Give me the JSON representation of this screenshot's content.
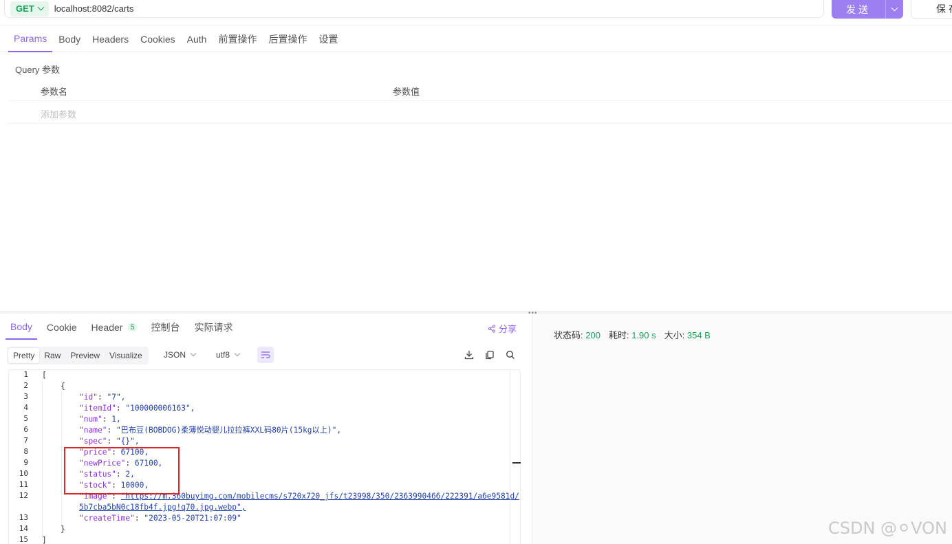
{
  "request": {
    "method": "GET",
    "url": "localhost:8082/carts",
    "send_label": "发送",
    "save_label": "保存"
  },
  "request_tabs": [
    "Params",
    "Body",
    "Headers",
    "Cookies",
    "Auth",
    "前置操作",
    "后置操作",
    "设置"
  ],
  "params": {
    "section_title": "Query 参数",
    "col_name": "参数名",
    "col_value": "参数值",
    "add_placeholder": "添加参数"
  },
  "response_tabs": {
    "body": "Body",
    "cookie": "Cookie",
    "header": "Header",
    "header_count": "5",
    "console": "控制台",
    "actual_request": "实际请求",
    "share": "分享"
  },
  "view_modes": [
    "Pretty",
    "Raw",
    "Preview",
    "Visualize"
  ],
  "format": {
    "type": "JSON",
    "encoding": "utf8"
  },
  "status": {
    "code_label": "状态码:",
    "code": "200",
    "time_label": "耗时:",
    "time": "1.90 s",
    "size_label": "大小:",
    "size": "354 B"
  },
  "code_lines": [
    {
      "n": "1",
      "text": "["
    },
    {
      "n": "2",
      "text": "    {"
    },
    {
      "n": "3",
      "key": "id",
      "val": "\"7\","
    },
    {
      "n": "4",
      "key": "itemId",
      "val": "\"100000006163\","
    },
    {
      "n": "5",
      "key": "num",
      "val": "1,"
    },
    {
      "n": "6",
      "key": "name",
      "val": "\"巴布豆(BOBDOG)柔薄悦动婴儿拉拉裤XXL码80片(15kg以上)\","
    },
    {
      "n": "7",
      "key": "spec",
      "val": "\"{}\","
    },
    {
      "n": "8",
      "key": "price",
      "val": "67100,"
    },
    {
      "n": "9",
      "key": "newPrice",
      "val": "67100,"
    },
    {
      "n": "10",
      "key": "status",
      "val": "2,"
    },
    {
      "n": "11",
      "key": "stock",
      "val": "10000,"
    },
    {
      "n": "12",
      "key": "image",
      "val": "\"https://m.360buyimg.com/mobilecms/s720x720_jfs/t23998/350/2363990466/222391/a6e9581d/",
      "cont": "5b7cba5bN0c18fb4f.jpg!q70.jpg.webp\","
    },
    {
      "n": "13",
      "key": "createTime",
      "val": "\"2023-05-20T21:07:09\""
    },
    {
      "n": "14",
      "text": "    }"
    },
    {
      "n": "15",
      "text": "]"
    }
  ],
  "watermark": "CSDN @⚪VON",
  "colors": {
    "accent": "#8a66e6",
    "send_button": "#9c7ff0",
    "get_method": "#1aa057",
    "highlight_box": "#d9272e"
  }
}
